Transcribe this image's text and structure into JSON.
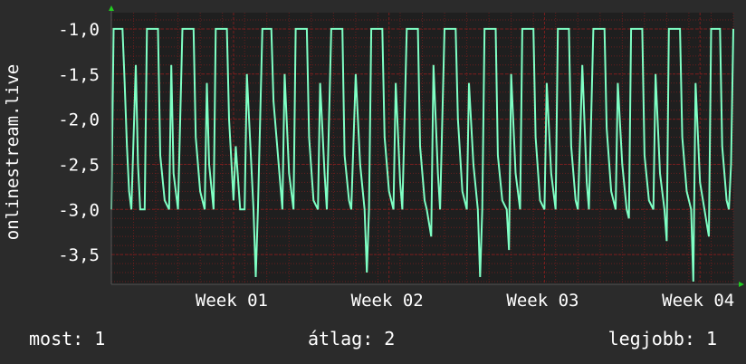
{
  "colors": {
    "background": "#2b2b2b",
    "plot_background": "#1f1f1f",
    "grid": "#7a1f1f",
    "line": "#7fffc4",
    "axis_arrow": "#22cc22",
    "text": "#ffffff"
  },
  "legend": {
    "now_label": "most:",
    "now_value": "1",
    "avg_label": "átlag:",
    "avg_value": "2",
    "best_label": "legjobb:",
    "best_value": "1"
  },
  "chart_data": {
    "type": "line",
    "title": "",
    "xlabel": "",
    "ylabel": "onlinestream.live",
    "ylim": [
      -3.83,
      -0.82
    ],
    "xlim": [
      0,
      28
    ],
    "y_ticks": [
      -1.0,
      -1.5,
      -2.0,
      -2.5,
      -3.0,
      -3.5
    ],
    "y_tick_labels": [
      "-1,0",
      "-1,5",
      "-2,0",
      "-2,5",
      "-3,0",
      "-3,5"
    ],
    "x_ticks": [
      5.5,
      12.5,
      19.5,
      26.5
    ],
    "x_tick_labels": [
      "Week 01",
      "Week 02",
      "Week 03",
      "Week 04"
    ],
    "grid": true,
    "series": [
      {
        "values": [
          [
            0.0,
            -3.0
          ],
          [
            0.1,
            -1.0
          ],
          [
            0.5,
            -1.0
          ],
          [
            0.6,
            -1.6
          ],
          [
            0.7,
            -2.3
          ],
          [
            0.8,
            -2.8
          ],
          [
            0.9,
            -3.0
          ],
          [
            1.1,
            -1.4
          ],
          [
            1.2,
            -2.5
          ],
          [
            1.3,
            -3.0
          ],
          [
            1.5,
            -3.0
          ],
          [
            1.6,
            -1.0
          ],
          [
            2.1,
            -1.0
          ],
          [
            2.2,
            -2.4
          ],
          [
            2.4,
            -2.9
          ],
          [
            2.6,
            -3.0
          ],
          [
            2.7,
            -1.4
          ],
          [
            2.8,
            -2.6
          ],
          [
            3.0,
            -3.0
          ],
          [
            3.2,
            -1.0
          ],
          [
            3.7,
            -1.0
          ],
          [
            3.8,
            -2.2
          ],
          [
            4.0,
            -2.8
          ],
          [
            4.2,
            -3.0
          ],
          [
            4.3,
            -1.6
          ],
          [
            4.4,
            -2.5
          ],
          [
            4.6,
            -3.0
          ],
          [
            4.7,
            -1.0
          ],
          [
            5.2,
            -1.0
          ],
          [
            5.3,
            -2.0
          ],
          [
            5.5,
            -2.9
          ],
          [
            5.6,
            -2.3
          ],
          [
            5.8,
            -3.0
          ],
          [
            6.0,
            -3.0
          ],
          [
            6.1,
            -1.5
          ],
          [
            6.2,
            -2.0
          ],
          [
            6.4,
            -3.0
          ],
          [
            6.5,
            -3.75
          ],
          [
            6.6,
            -3.0
          ],
          [
            6.8,
            -1.0
          ],
          [
            7.2,
            -1.0
          ],
          [
            7.3,
            -1.8
          ],
          [
            7.5,
            -2.4
          ],
          [
            7.7,
            -3.0
          ],
          [
            7.8,
            -1.5
          ],
          [
            8.0,
            -2.6
          ],
          [
            8.2,
            -3.0
          ],
          [
            8.3,
            -1.0
          ],
          [
            8.8,
            -1.0
          ],
          [
            8.9,
            -2.2
          ],
          [
            9.1,
            -2.9
          ],
          [
            9.3,
            -3.0
          ],
          [
            9.4,
            -1.6
          ],
          [
            9.6,
            -2.6
          ],
          [
            9.7,
            -3.0
          ],
          [
            9.9,
            -1.0
          ],
          [
            10.4,
            -1.0
          ],
          [
            10.5,
            -2.4
          ],
          [
            10.7,
            -2.9
          ],
          [
            10.8,
            -3.0
          ],
          [
            11.0,
            -1.5
          ],
          [
            11.2,
            -2.5
          ],
          [
            11.4,
            -3.0
          ],
          [
            11.5,
            -3.7
          ],
          [
            11.6,
            -3.0
          ],
          [
            11.7,
            -1.0
          ],
          [
            12.2,
            -1.0
          ],
          [
            12.3,
            -2.2
          ],
          [
            12.5,
            -2.8
          ],
          [
            12.7,
            -3.0
          ],
          [
            12.8,
            -1.6
          ],
          [
            13.0,
            -2.7
          ],
          [
            13.1,
            -3.0
          ],
          [
            13.3,
            -1.0
          ],
          [
            13.8,
            -1.0
          ],
          [
            13.9,
            -2.3
          ],
          [
            14.1,
            -2.9
          ],
          [
            14.2,
            -3.0
          ],
          [
            14.4,
            -3.3
          ],
          [
            14.5,
            -1.4
          ],
          [
            14.7,
            -2.6
          ],
          [
            14.8,
            -3.0
          ],
          [
            15.0,
            -1.0
          ],
          [
            15.5,
            -1.0
          ],
          [
            15.6,
            -2.0
          ],
          [
            15.8,
            -2.8
          ],
          [
            16.0,
            -3.0
          ],
          [
            16.1,
            -1.6
          ],
          [
            16.3,
            -2.5
          ],
          [
            16.5,
            -3.0
          ],
          [
            16.6,
            -3.75
          ],
          [
            16.7,
            -3.0
          ],
          [
            16.8,
            -1.0
          ],
          [
            17.3,
            -1.0
          ],
          [
            17.4,
            -2.4
          ],
          [
            17.6,
            -2.9
          ],
          [
            17.8,
            -3.0
          ],
          [
            17.9,
            -3.45
          ],
          [
            18.0,
            -1.5
          ],
          [
            18.2,
            -2.6
          ],
          [
            18.4,
            -3.0
          ],
          [
            18.5,
            -1.0
          ],
          [
            19.0,
            -1.0
          ],
          [
            19.1,
            -2.2
          ],
          [
            19.3,
            -2.9
          ],
          [
            19.5,
            -3.0
          ],
          [
            19.6,
            -1.6
          ],
          [
            19.8,
            -2.6
          ],
          [
            20.0,
            -3.0
          ],
          [
            20.1,
            -1.0
          ],
          [
            20.6,
            -1.0
          ],
          [
            20.7,
            -2.3
          ],
          [
            20.9,
            -2.9
          ],
          [
            21.0,
            -3.0
          ],
          [
            21.2,
            -1.4
          ],
          [
            21.4,
            -2.7
          ],
          [
            21.5,
            -3.0
          ],
          [
            21.7,
            -1.0
          ],
          [
            22.2,
            -1.0
          ],
          [
            22.3,
            -2.1
          ],
          [
            22.5,
            -2.8
          ],
          [
            22.7,
            -3.0
          ],
          [
            22.8,
            -1.6
          ],
          [
            23.0,
            -2.5
          ],
          [
            23.2,
            -3.0
          ],
          [
            23.3,
            -3.1
          ],
          [
            23.4,
            -1.0
          ],
          [
            23.9,
            -1.0
          ],
          [
            24.0,
            -2.4
          ],
          [
            24.2,
            -2.9
          ],
          [
            24.4,
            -3.0
          ],
          [
            24.5,
            -1.5
          ],
          [
            24.7,
            -2.6
          ],
          [
            24.9,
            -3.0
          ],
          [
            25.0,
            -3.35
          ],
          [
            25.1,
            -1.0
          ],
          [
            25.6,
            -1.0
          ],
          [
            25.7,
            -2.2
          ],
          [
            25.9,
            -2.8
          ],
          [
            26.1,
            -3.0
          ],
          [
            26.2,
            -3.8
          ],
          [
            26.3,
            -1.6
          ],
          [
            26.5,
            -2.7
          ],
          [
            26.7,
            -3.0
          ],
          [
            26.9,
            -3.3
          ],
          [
            27.0,
            -1.0
          ],
          [
            27.4,
            -1.0
          ],
          [
            27.5,
            -2.3
          ],
          [
            27.7,
            -2.9
          ],
          [
            27.8,
            -3.0
          ],
          [
            27.9,
            -2.5
          ],
          [
            28.0,
            -1.0
          ]
        ]
      }
    ]
  }
}
